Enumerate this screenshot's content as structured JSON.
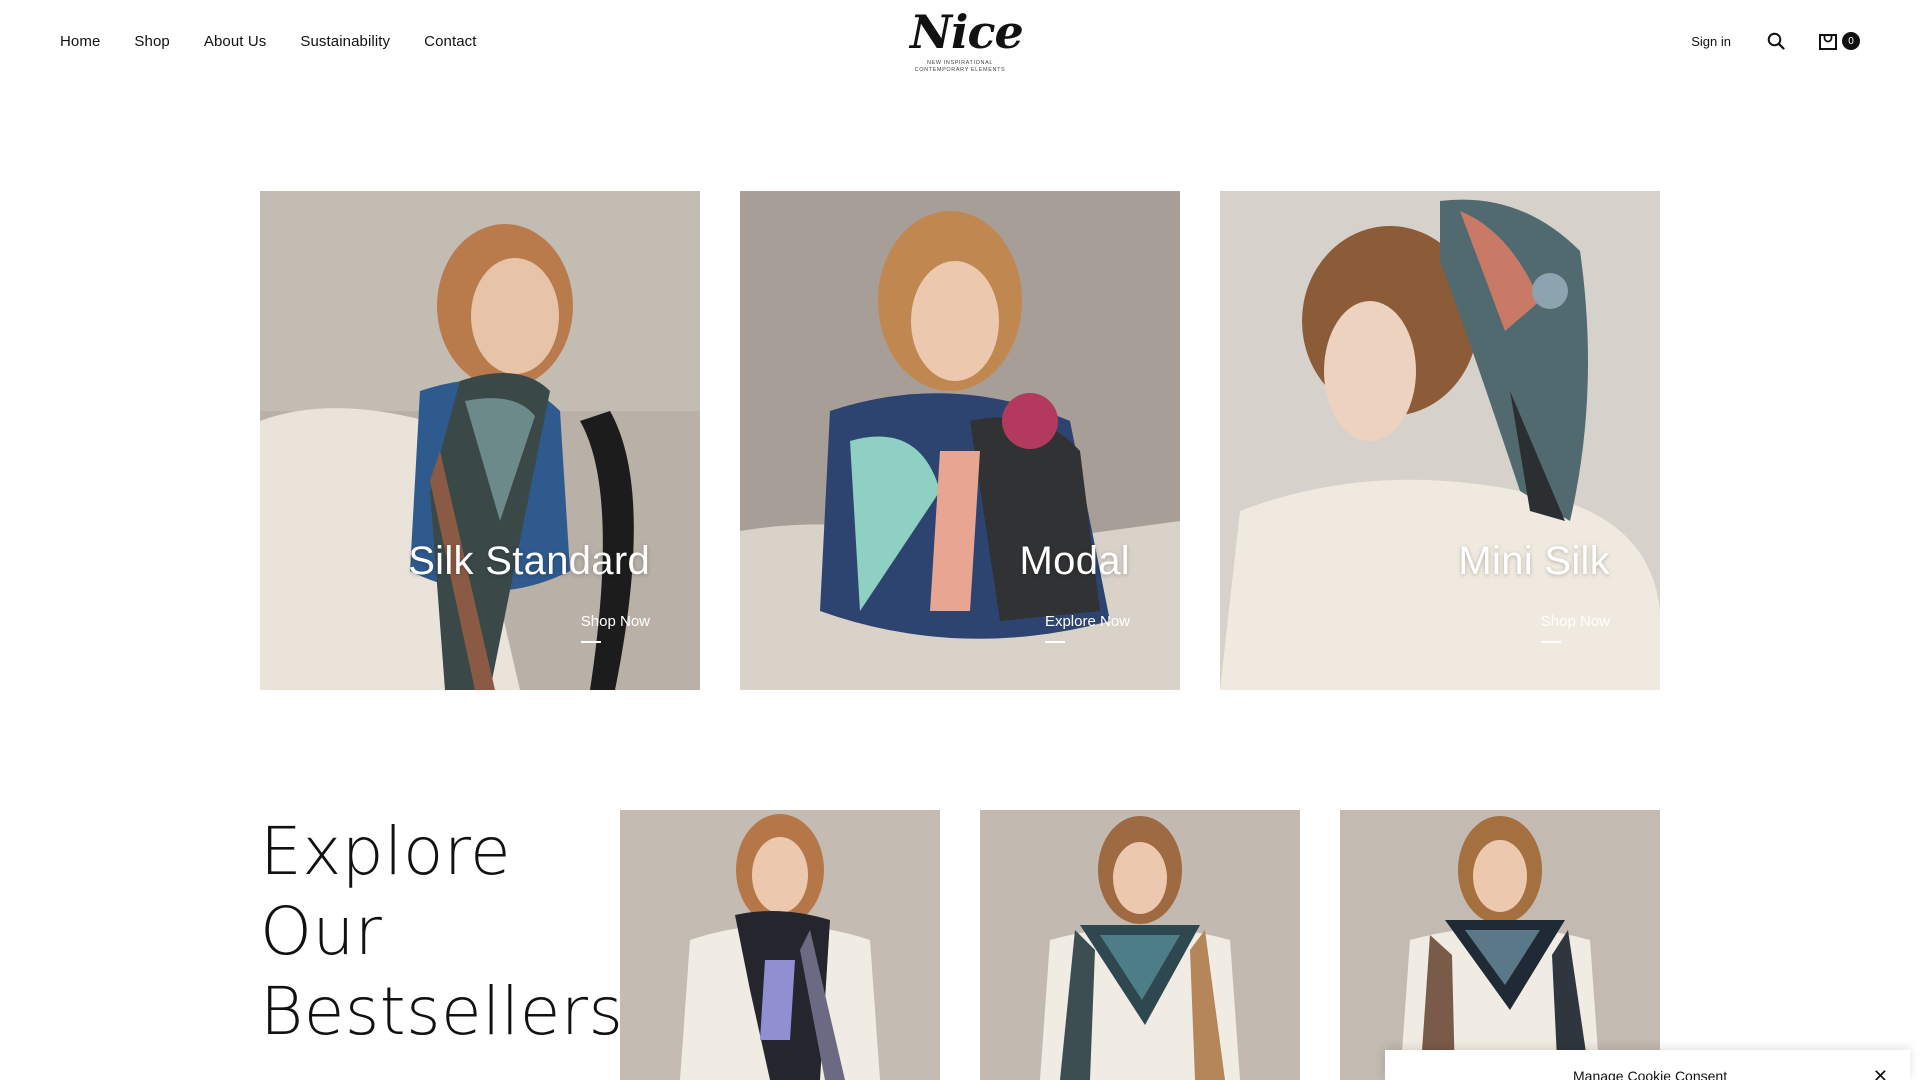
{
  "nav": {
    "items": [
      "Home",
      "Shop",
      "About Us",
      "Sustainability",
      "Contact"
    ]
  },
  "logo": {
    "wordmark": "Nice",
    "tagline_line1": "NEW INSPIRATIONAL",
    "tagline_line2": "CONTEMPORARY ELEMENTS"
  },
  "header": {
    "signin_label": "Sign in",
    "cart_count": "0"
  },
  "categories": [
    {
      "title": "Silk Standard",
      "link": "Shop Now"
    },
    {
      "title": "Modal",
      "link": "Explore Now"
    },
    {
      "title": "Mini Silk",
      "link": "Shop Now"
    }
  ],
  "bestsellers": {
    "heading_line1": "Explore",
    "heading_line2": "Our",
    "heading_line3": "Bestsellers"
  },
  "cookie": {
    "label": "Manage Cookie Consent",
    "close": "✕"
  },
  "colors": {
    "text": "#111111",
    "background": "#ffffff",
    "photo_backdrop": "#bdb4ab"
  }
}
